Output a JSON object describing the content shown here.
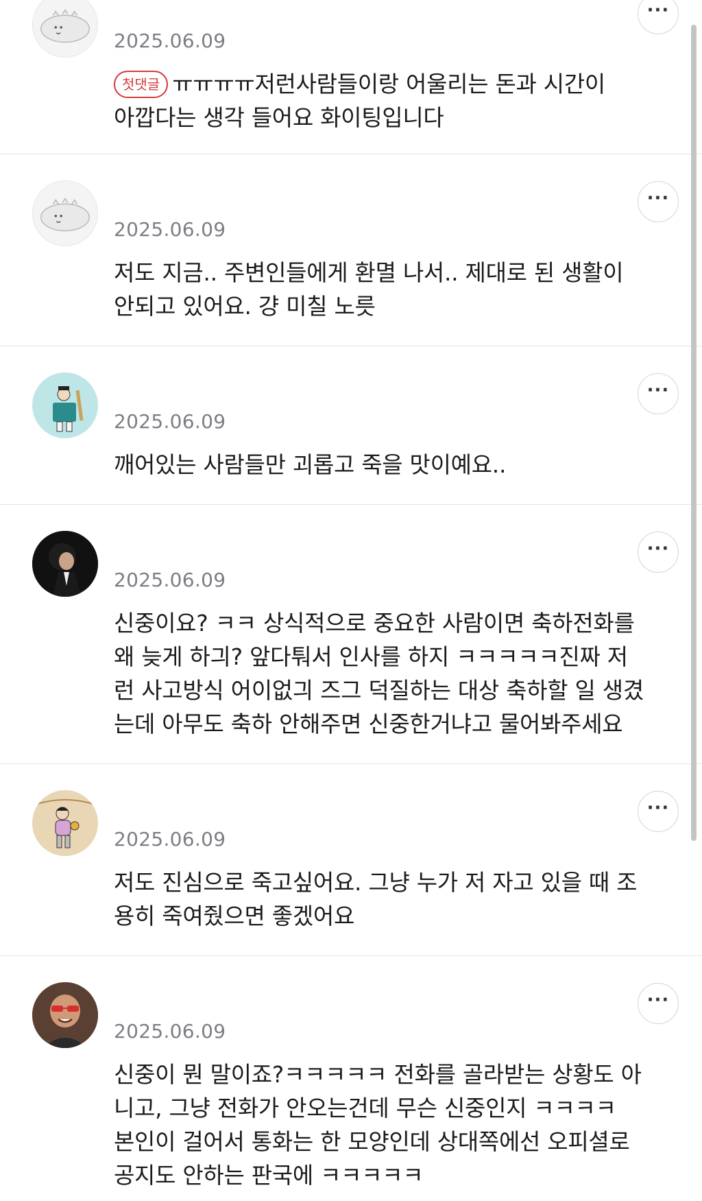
{
  "comments": [
    {
      "date": "2025.06.09",
      "badge": "첫댓글",
      "text": "ㅠㅠㅠㅠ저런사람들이랑 어울리는 돈과 시간이\n아깝다는 생각 들어요 화이팅입니다",
      "avatar": "dinosaur-doodle-avatar",
      "more_icon": "ellipsis-icon"
    },
    {
      "date": "2025.06.09",
      "text": "저도 지금.. 주변인들에게 환멸 나서.. 제대로 된 생활이\n안되고 있어요. 걍 미칠 노릇",
      "avatar": "dinosaur-doodle-avatar",
      "more_icon": "ellipsis-icon"
    },
    {
      "date": "2025.06.09",
      "text": "깨어있는 사람들만 괴롭고 죽을 맛이예요..",
      "avatar": "traditional-figure-avatar",
      "more_icon": "ellipsis-icon"
    },
    {
      "date": "2025.06.09",
      "text": "신중이요? ㅋㅋ 상식적으로 중요한 사람이면 축하전화를\n왜 늦게 하긔? 앞다퉈서 인사를 하지 ㅋㅋㅋㅋㅋ진짜 저\n런 사고방식 어이없긔 즈그 덕질하는 대상 축하할 일 생겼\n는데 아무도 축하 안해주면 신중한거냐고 물어봐주세요",
      "avatar": "performer-photo-avatar",
      "more_icon": "ellipsis-icon"
    },
    {
      "date": "2025.06.09",
      "text": "저도 진심으로 죽고싶어요. 그냥 누가 저 자고 있을 때 조\n용히 죽여줬으면 좋겠어요",
      "avatar": "character-illustration-avatar",
      "more_icon": "ellipsis-icon"
    },
    {
      "date": "2025.06.09",
      "text": "신중이 뭔 말이죠?ㅋㅋㅋㅋㅋ 전화를 골라받는 상황도 아\n니고, 그냥 전화가 안오는건데 무슨 신중인지 ㅋㅋㅋㅋ\n본인이 걸어서 통화는 한 모양인데 상대쪽에선 오피셜로\n공지도 안하는 판국에 ㅋㅋㅋㅋㅋ",
      "avatar": "man-with-sunglasses-avatar",
      "more_icon": "ellipsis-icon"
    }
  ],
  "colors": {
    "badge": "#d43a3a",
    "date": "#7d7d85",
    "divider": "#e3e3e3"
  }
}
